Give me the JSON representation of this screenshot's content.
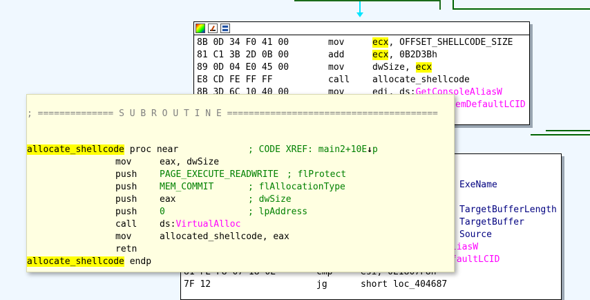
{
  "colors": {
    "background": "#f0f8ff",
    "edge_cyan": "#00e5ff",
    "edge_green": "#006400",
    "highlight": "#ffff00",
    "tooltip_bg": "#ffffe1",
    "import_pink": "#ff00ff",
    "comment_green": "#008000"
  },
  "top_block": {
    "toolbar_icons": [
      "color-palette-icon",
      "edit-node-icon",
      "graph-overview-icon"
    ],
    "rows": [
      {
        "bytes": "8B 0D 34 F0 41 00",
        "mnemonic": "mov",
        "op_hl": "ecx",
        "op_rest": ", OFFSET_SHELLCODE_SIZE",
        "op_rest_hl": ""
      },
      {
        "bytes": "81 C1 3B 2D 0B 00",
        "mnemonic": "add",
        "op_hl": "ecx",
        "op_rest": ", 0B2D3Bh",
        "op_rest_hl": ""
      },
      {
        "bytes": "89 0D 04 E0 45 00",
        "mnemonic": "mov",
        "op_hl": "",
        "op_rest": "dwSize, ",
        "op_rest_hl": "ecx"
      },
      {
        "bytes": "E8 CD FE FF FF",
        "mnemonic": "call",
        "op_hl": "",
        "op_rest": "allocate_shellcode",
        "op_rest_hl": ""
      },
      {
        "bytes": "8B 3D 6C 10 40 00",
        "mnemonic": "mov",
        "op_hl": "",
        "op_rest": "edi, ds:",
        "op_rest_hl": "",
        "op_import": "GetConsoleAliasW"
      }
    ],
    "partial_row": {
      "import": "emDefaultLCID"
    }
  },
  "bottom_block": {
    "right_labels": [
      "ExeName",
      "TargetBufferLength",
      "TargetBuffer",
      "Source"
    ],
    "partial_imports": [
      "liasW",
      "faultLCID"
    ],
    "rows": [
      {
        "bytes": "81 FE F8 07 18 0E",
        "mnemonic": "cmp",
        "operands": "esi, 0E1807F8h"
      },
      {
        "bytes": "7F 12",
        "mnemonic": "jg",
        "operands": "short loc_404687"
      }
    ]
  },
  "tooltip": {
    "separator_prefix": "; ============== ",
    "separator_title": "S U B R O U T I N E",
    "separator_suffix": " =======================================",
    "proc_name": "allocate_shellcode",
    "proc_decl": " proc near",
    "proc_comment": "; CODE XREF: main2+10E",
    "proc_comment_tail": "p",
    "instructions": [
      {
        "mnemonic": "mov",
        "operands": "eax, dwSize",
        "comment": ""
      },
      {
        "mnemonic": "push",
        "operands": "PAGE_EXECUTE_READWRITE",
        "comment": "; flProtect"
      },
      {
        "mnemonic": "push",
        "operands": "MEM_COMMIT",
        "comment": "; flAllocationType"
      },
      {
        "mnemonic": "push",
        "operands": "eax",
        "comment": "; dwSize"
      },
      {
        "mnemonic": "push",
        "operands": "0",
        "comment": "; lpAddress"
      },
      {
        "mnemonic": "call",
        "operands_prefix": "ds:",
        "operands_import": "VirtualAlloc",
        "comment": ""
      },
      {
        "mnemonic": "mov",
        "operands": "allocated_shellcode, eax",
        "comment": ""
      },
      {
        "mnemonic": "retn",
        "operands": "",
        "comment": ""
      }
    ],
    "endp_name": "allocate_shellcode",
    "endp_decl": " endp"
  }
}
